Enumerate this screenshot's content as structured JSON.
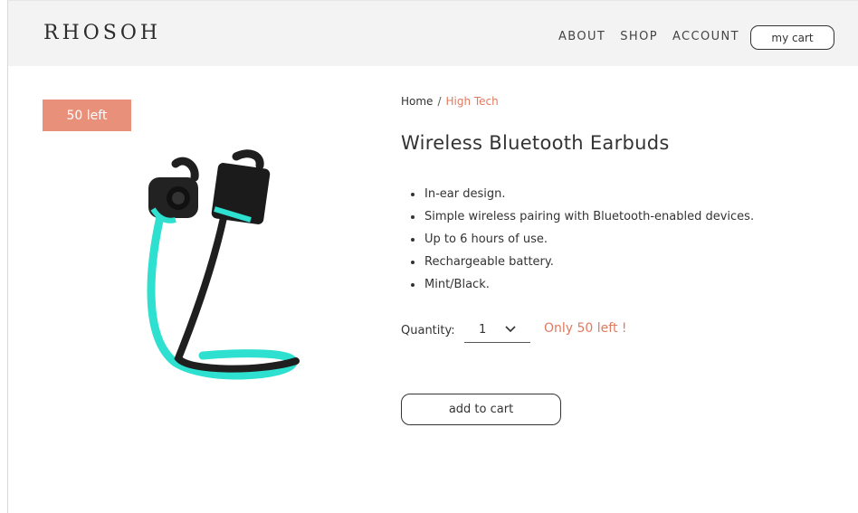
{
  "header": {
    "logo": "RHOSOH",
    "nav": [
      "ABOUT",
      "SHOP",
      "ACCOUNT"
    ],
    "cart_label": "my cart"
  },
  "badge": {
    "label": "50 left",
    "color": "#e8907a"
  },
  "breadcrumb": {
    "home": "Home",
    "separator": "/",
    "current": "High Tech"
  },
  "product": {
    "title": "Wireless Bluetooth Earbuds",
    "features": [
      "In-ear design.",
      "Simple wireless pairing with Bluetooth-enabled devices.",
      "Up to 6 hours of use.",
      "Rechargeable battery.",
      "Mint/Black."
    ],
    "image_icon": "earbuds-image",
    "colors": {
      "mint": "#2ee0cf",
      "black": "#1f1f1f"
    }
  },
  "quantity": {
    "label": "Quantity:",
    "value": "1",
    "stock_note": "Only 50 left !"
  },
  "actions": {
    "add_to_cart": "add to cart"
  },
  "theme": {
    "accent": "#e07a5f",
    "header_bg": "#f3f3f3"
  }
}
